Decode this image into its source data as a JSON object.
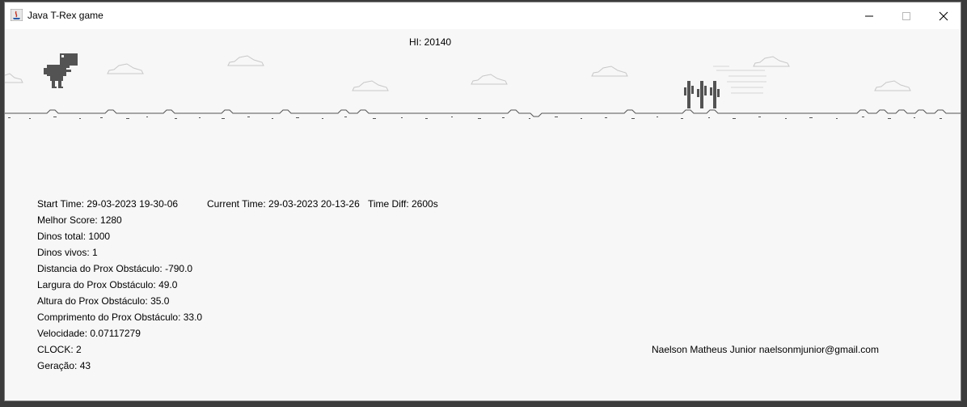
{
  "window": {
    "title": "Java T-Rex game",
    "controls": [
      "minimize-icon",
      "maximize-icon",
      "close-icon"
    ]
  },
  "game": {
    "hi_score": "HI: 20140",
    "stats": {
      "start_time": "Start Time: 29-03-2023 19-30-06",
      "current_time": "Current Time: 29-03-2023 20-13-26",
      "time_diff": "Time Diff: 2600s",
      "melhor_score": "Melhor Score: 1280",
      "dinos_total": "Dinos total: 1000",
      "dinos_vivos": "Dinos vivos: 1",
      "distancia": "Distancia do Prox Obstáculo: -790.0",
      "largura": "Largura do Prox Obstáculo: 49.0",
      "altura": "Altura do Prox Obstáculo: 35.0",
      "comprimento": "Comprimento do Prox Obstáculo: 33.0",
      "velocidade": "Velocidade: 0.07117279",
      "clock": "CLOCK: 2",
      "geracao": "Geração: 43"
    },
    "credit": "Naelson Matheus Junior naelsonmjunior@gmail.com"
  },
  "colors": {
    "sprite": "#535353",
    "cloud": "#d0d0d0",
    "background": "#f7f7f7"
  }
}
